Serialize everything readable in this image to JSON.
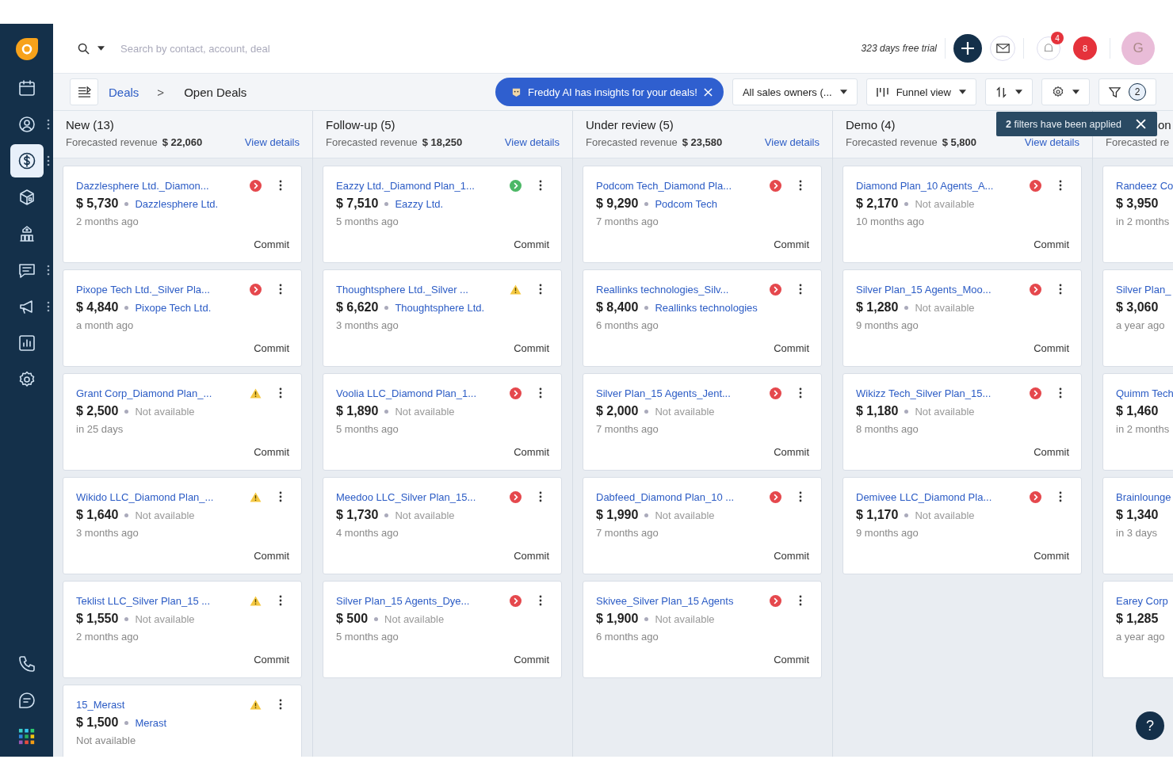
{
  "sidebar": {
    "top_items": [
      {
        "selected": false,
        "has_menu": false
      },
      {
        "selected": false,
        "has_menu": true
      },
      {
        "selected": true,
        "has_menu": true
      },
      {
        "selected": false,
        "has_menu": false
      },
      {
        "selected": false,
        "has_menu": false
      },
      {
        "selected": false,
        "has_menu": true
      },
      {
        "selected": false,
        "has_menu": true
      },
      {
        "selected": false,
        "has_menu": false
      },
      {
        "selected": false,
        "has_menu": false
      }
    ],
    "bottom_items": [
      {
        "selected": false
      },
      {
        "selected": false
      },
      {
        "selected": false
      }
    ]
  },
  "header": {
    "search": {
      "placeholder": "Search by contact, account, deal"
    },
    "trial": "323 days free trial",
    "notifications_badge": "4",
    "alerts_badge": "8",
    "avatar": "G"
  },
  "toolbar": {
    "breadcrumb": [
      {
        "label": "Deals",
        "link": true
      },
      {
        "label": "Open Deals",
        "link": false
      }
    ],
    "separator": ">",
    "freddy": "Freddy AI has insights for your deals!",
    "owner_filter": "All sales owners (...",
    "view": "Funnel view",
    "filter_count": "2"
  },
  "toast": "**2** filters have been applied",
  "columns": [
    {
      "title": "New (13)",
      "revenue_label": "Forecasted revenue",
      "revenue": "$ 22,060",
      "link": "View details",
      "cards": [
        {
          "title": "Dazzlesphere Ltd._Diamon...",
          "amount": "$ 5,730",
          "account": "Dazzlesphere Ltd.",
          "account_linked": true,
          "time": "2 months ago",
          "alert": {
            "kind": "arrow",
            "color": "#e5484d"
          },
          "category": "Commit"
        },
        {
          "title": "Pixope Tech Ltd._Silver Pla...",
          "amount": "$ 4,840",
          "account": "Pixope Tech Ltd.",
          "account_linked": true,
          "time": "a month ago",
          "alert": {
            "kind": "arrow",
            "color": "#e5484d"
          },
          "category": "Commit"
        },
        {
          "title": "Grant Corp_Diamond Plan_...",
          "amount": "$ 2,500",
          "account": "Not available",
          "account_linked": false,
          "time": "in 25 days",
          "alert": {
            "kind": "warning",
            "color": "#f5c842"
          },
          "category": "Commit"
        },
        {
          "title": "Wikido LLC_Diamond Plan_...",
          "amount": "$ 1,640",
          "account": "Not available",
          "account_linked": false,
          "time": "3 months ago",
          "alert": {
            "kind": "warning",
            "color": "#f5c842"
          },
          "category": "Commit"
        },
        {
          "title": "Teklist LLC_Silver Plan_15 ...",
          "amount": "$ 1,550",
          "account": "Not available",
          "account_linked": false,
          "time": "2 months ago",
          "alert": {
            "kind": "warning",
            "color": "#f5c842"
          },
          "category": "Commit"
        },
        {
          "title": "15_Merast",
          "amount": "$ 1,500",
          "account": "Merast",
          "account_linked": true,
          "time": "Not available",
          "alert": {
            "kind": "warning",
            "color": "#f5c842"
          }
        }
      ]
    },
    {
      "title": "Follow-up (5)",
      "revenue_label": "Forecasted revenue",
      "revenue": "$ 18,250",
      "link": "View details",
      "cards": [
        {
          "title": "Eazzy Ltd._Diamond Plan_1...",
          "amount": "$ 7,510",
          "account": "Eazzy Ltd.",
          "account_linked": true,
          "time": "5 months ago",
          "alert": {
            "kind": "arrow",
            "color": "#4cb866"
          },
          "category": "Commit"
        },
        {
          "title": "Thoughtsphere Ltd._Silver ...",
          "amount": "$ 6,620",
          "account": "Thoughtsphere Ltd.",
          "account_linked": true,
          "time": "3 months ago",
          "alert": {
            "kind": "warning",
            "color": "#f5c842"
          },
          "category": "Commit"
        },
        {
          "title": "Voolia LLC_Diamond Plan_1...",
          "amount": "$ 1,890",
          "account": "Not available",
          "account_linked": false,
          "time": "5 months ago",
          "alert": {
            "kind": "arrow",
            "color": "#e5484d"
          },
          "category": "Commit"
        },
        {
          "title": "Meedoo LLC_Silver Plan_15...",
          "amount": "$ 1,730",
          "account": "Not available",
          "account_linked": false,
          "time": "4 months ago",
          "alert": {
            "kind": "arrow",
            "color": "#e5484d"
          },
          "category": "Commit"
        },
        {
          "title": "Silver Plan_15 Agents_Dye...",
          "amount": "$ 500",
          "account": "Not available",
          "account_linked": false,
          "time": "5 months ago",
          "alert": {
            "kind": "arrow",
            "color": "#e5484d"
          },
          "category": "Commit"
        }
      ]
    },
    {
      "title": "Under review (5)",
      "revenue_label": "Forecasted revenue",
      "revenue": "$ 23,580",
      "link": "View details",
      "cards": [
        {
          "title": "Podcom Tech_Diamond Pla...",
          "amount": "$ 9,290",
          "account": "Podcom Tech",
          "account_linked": true,
          "time": "7 months ago",
          "alert": {
            "kind": "arrow",
            "color": "#e5484d"
          },
          "category": "Commit"
        },
        {
          "title": "Reallinks technologies_Silv...",
          "amount": "$ 8,400",
          "account": "Reallinks technologies",
          "account_linked": true,
          "time": "6 months ago",
          "alert": {
            "kind": "arrow",
            "color": "#e5484d"
          },
          "category": "Commit"
        },
        {
          "title": "Silver Plan_15 Agents_Jent...",
          "amount": "$ 2,000",
          "account": "Not available",
          "account_linked": false,
          "time": "7 months ago",
          "alert": {
            "kind": "arrow",
            "color": "#e5484d"
          },
          "category": "Commit"
        },
        {
          "title": "Dabfeed_Diamond Plan_10 ...",
          "amount": "$ 1,990",
          "account": "Not available",
          "account_linked": false,
          "time": "7 months ago",
          "alert": {
            "kind": "arrow",
            "color": "#e5484d"
          },
          "category": "Commit"
        },
        {
          "title": "Skivee_Silver Plan_15 Agents",
          "amount": "$ 1,900",
          "account": "Not available",
          "account_linked": false,
          "time": "6 months ago",
          "alert": {
            "kind": "arrow",
            "color": "#e5484d"
          },
          "category": "Commit"
        }
      ]
    },
    {
      "title": "Demo (4)",
      "revenue_label": "Forecasted revenue",
      "revenue": "$ 5,800",
      "link": "View details",
      "cards": [
        {
          "title": "Diamond Plan_10 Agents_A...",
          "amount": "$ 2,170",
          "account": "Not available",
          "account_linked": false,
          "time": "10 months ago",
          "alert": {
            "kind": "arrow",
            "color": "#e5484d"
          },
          "category": "Commit"
        },
        {
          "title": "Silver Plan_15 Agents_Moo...",
          "amount": "$ 1,280",
          "account": "Not available",
          "account_linked": false,
          "time": "9 months ago",
          "alert": {
            "kind": "arrow",
            "color": "#e5484d"
          },
          "category": "Commit"
        },
        {
          "title": "Wikizz Tech_Silver Plan_15...",
          "amount": "$ 1,180",
          "account": "Not available",
          "account_linked": false,
          "time": "8 months ago",
          "alert": {
            "kind": "arrow",
            "color": "#e5484d"
          },
          "category": "Commit"
        },
        {
          "title": "Demivee LLC_Diamond Pla...",
          "amount": "$ 1,170",
          "account": "Not available",
          "account_linked": false,
          "time": "9 months ago",
          "alert": {
            "kind": "arrow",
            "color": "#e5484d"
          },
          "category": "Commit"
        }
      ]
    },
    {
      "title": "on",
      "revenue_label": "Forecasted re",
      "cards": [
        {
          "title": "Randeez Co",
          "amount": "$ 3,950",
          "time": "in 2 months"
        },
        {
          "title": "Silver Plan_",
          "amount": "$ 3,060",
          "time": "a year ago"
        },
        {
          "title": "Quimm Tech",
          "amount": "$ 1,460",
          "time": "in 2 months"
        },
        {
          "title": "Brainlounge",
          "amount": "$ 1,340",
          "time": "in 3 days"
        },
        {
          "title": "Earey Corp",
          "amount": "$ 1,285",
          "time": "a year ago"
        }
      ]
    }
  ],
  "help": "?"
}
